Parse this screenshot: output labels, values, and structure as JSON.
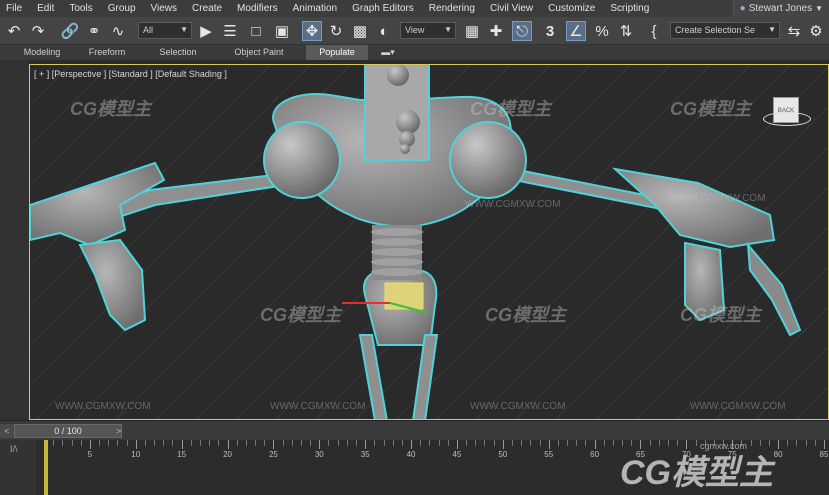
{
  "menu": {
    "items": [
      "File",
      "Edit",
      "Tools",
      "Group",
      "Views",
      "Create",
      "Modifiers",
      "Animation",
      "Graph Editors",
      "Rendering",
      "Civil View",
      "Customize",
      "Scripting"
    ],
    "user": "Stewart Jones"
  },
  "toolbar": {
    "selection_filter": "All",
    "reference_coord": "View",
    "named_selection": "Create Selection Se",
    "snap_value": "3"
  },
  "ribbon": {
    "tabs": [
      "Modeling",
      "Freeform",
      "Selection",
      "Object Paint",
      "Populate"
    ],
    "active_tab": "Populate"
  },
  "viewport": {
    "label": "[ + ] [Perspective ] [Standard ] [Default Shading ]",
    "viewcube_label": "BACK",
    "watermark_text": "CG模型主",
    "watermark_url": "WWW.CGMXW.COM"
  },
  "timeline": {
    "frame_counter": "0 / 100",
    "prev_symbol": "<",
    "next_symbol": ">",
    "key_label": "I/\\",
    "ticks": [
      5,
      10,
      15,
      20,
      25,
      30,
      35,
      40,
      45,
      50,
      55,
      60,
      65,
      70,
      75,
      80,
      85
    ]
  },
  "branding": {
    "logo_text": "CG模型主",
    "logo_url": "cgmxw.com"
  },
  "colors": {
    "selection_outline": "#4fd3d8",
    "viewport_border": "#d9c95a",
    "model_gray": "#9a9a9a",
    "accent_blue": "#5a6f86"
  }
}
